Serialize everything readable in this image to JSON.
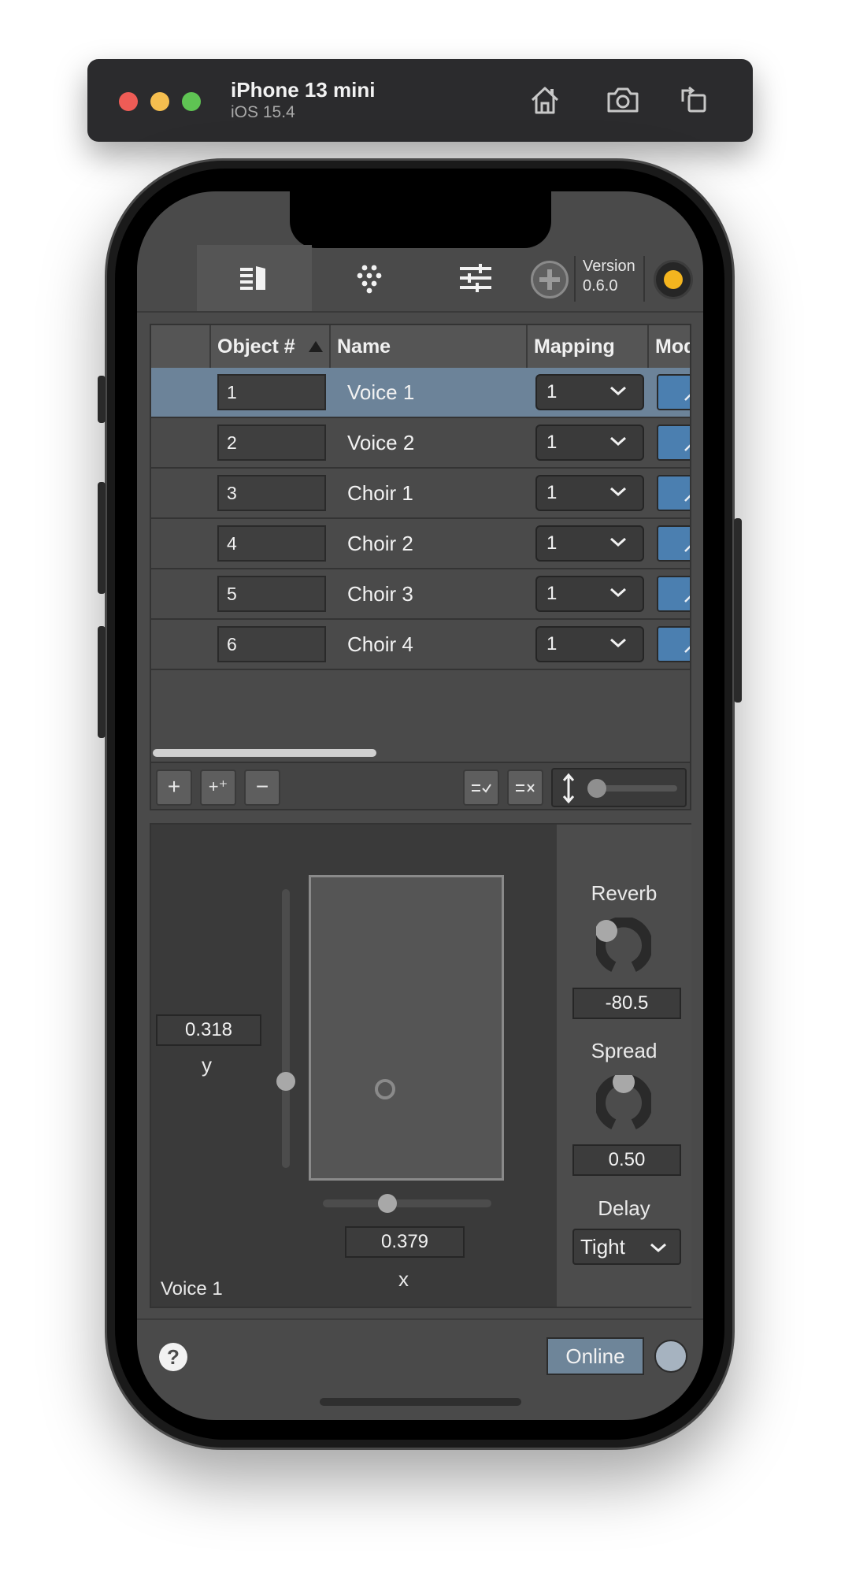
{
  "simulator": {
    "device_name": "iPhone 13 mini",
    "os_version": "iOS 15.4"
  },
  "toolbar": {
    "tabs": [
      {
        "icon": "list-icon",
        "active": true
      },
      {
        "icon": "dots-grid-icon",
        "active": false
      },
      {
        "icon": "sliders-icon",
        "active": false
      }
    ],
    "version_label": "Version",
    "version_value": "0.6.0",
    "status_color": "#f4b51f"
  },
  "table": {
    "columns": [
      "",
      "Object #",
      "Name",
      "Mapping",
      "Mode"
    ],
    "rows": [
      {
        "number": "1",
        "name": "Voice 1",
        "mapping": "1",
        "selected": true
      },
      {
        "number": "2",
        "name": "Voice 2",
        "mapping": "1",
        "selected": false
      },
      {
        "number": "3",
        "name": "Choir 1",
        "mapping": "1",
        "selected": false
      },
      {
        "number": "4",
        "name": "Choir 2",
        "mapping": "1",
        "selected": false
      },
      {
        "number": "5",
        "name": "Choir 3",
        "mapping": "1",
        "selected": false
      },
      {
        "number": "6",
        "name": "Choir 4",
        "mapping": "1",
        "selected": false
      }
    ],
    "footer": {
      "add_label": "+",
      "add_multi_label": "+⁺",
      "remove_label": "−"
    }
  },
  "panel": {
    "object_label": "Voice 1",
    "y_value": "0.318",
    "y_label": "y",
    "x_value": "0.379",
    "x_label": "x",
    "reverb_label": "Reverb",
    "reverb_value": "-80.5",
    "spread_label": "Spread",
    "spread_value": "0.50",
    "delay_label": "Delay",
    "delay_value": "Tight"
  },
  "bottom": {
    "help_label": "?",
    "online_label": "Online",
    "accent_color": "#6e8599"
  }
}
